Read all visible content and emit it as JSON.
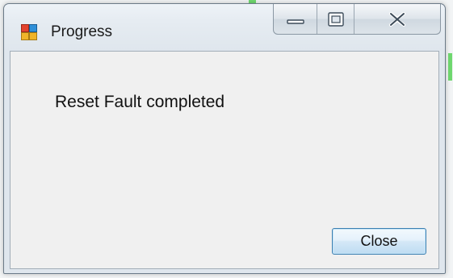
{
  "window": {
    "title": "Progress",
    "app_icon": "dialog-app-icon"
  },
  "caption_buttons": {
    "minimize_icon": "minimize-icon",
    "maximize_icon": "maximize-icon",
    "close_icon": "close-icon"
  },
  "content": {
    "message": "Reset Fault completed"
  },
  "footer": {
    "close_label": "Close"
  },
  "colors": {
    "accent_border": "#3c7fb1",
    "client_background": "#f0f0f0",
    "background_streak": "#6fd86f"
  }
}
